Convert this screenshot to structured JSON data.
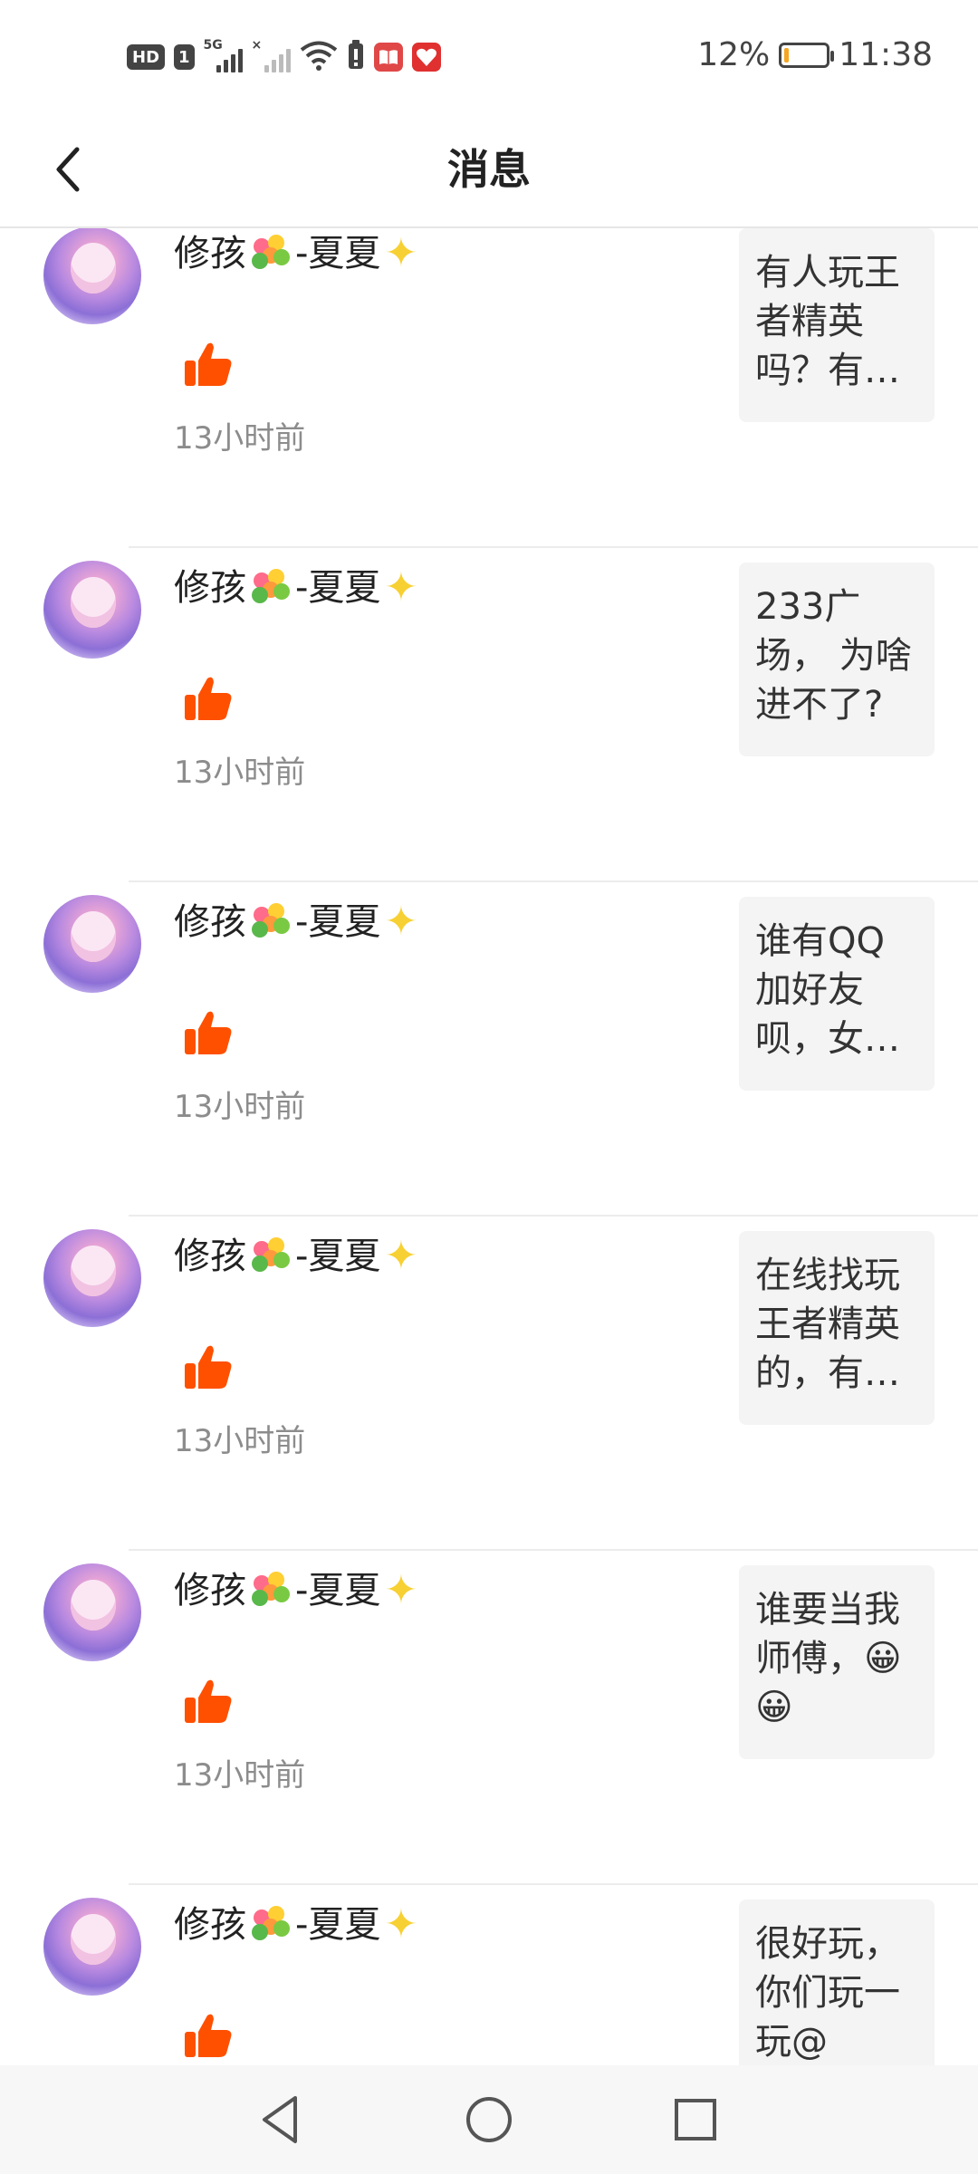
{
  "status_bar": {
    "hd_label": "HD",
    "sim_label": "1",
    "network_label": "5G",
    "battery_percent": "12%",
    "battery_level": 0.12,
    "time": "11:38"
  },
  "header": {
    "title": "消息"
  },
  "messages": [
    {
      "username": "修孩",
      "username_suffix": "-夏夏",
      "time": "13小时前",
      "quote": "有人玩王者精英吗？有…"
    },
    {
      "username": "修孩",
      "username_suffix": "-夏夏",
      "time": "13小时前",
      "quote": "233广场， 为啥进不了?"
    },
    {
      "username": "修孩",
      "username_suffix": "-夏夏",
      "time": "13小时前",
      "quote": "谁有QQ加好友呗，女…"
    },
    {
      "username": "修孩",
      "username_suffix": "-夏夏",
      "time": "13小时前",
      "quote": "在线找玩王者精英的，有…"
    },
    {
      "username": "修孩",
      "username_suffix": "-夏夏",
      "time": "13小时前",
      "quote": "谁要当我师傅，😀😀"
    },
    {
      "username": "修孩",
      "username_suffix": "-夏夏",
      "time": "",
      "quote": "很好玩，你们玩一玩@"
    }
  ],
  "icons": {
    "back": "chevron-left-icon",
    "like": "thumbs-up-icon",
    "nav_back": "triangle-back-icon",
    "nav_home": "circle-home-icon",
    "nav_recent": "square-recent-icon"
  },
  "colors": {
    "like": "#ff5000",
    "sparkle": "#f7d033",
    "battery_low": "#f5a623"
  }
}
